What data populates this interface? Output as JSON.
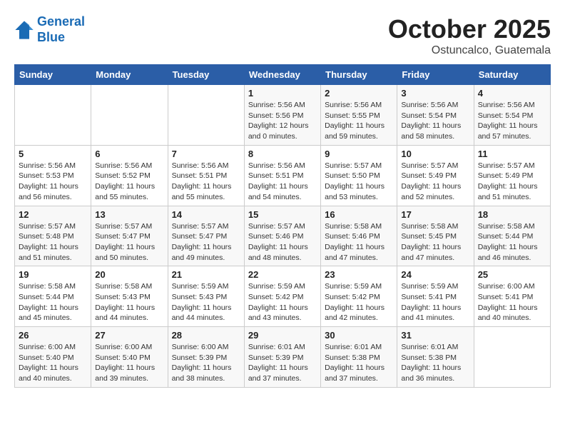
{
  "header": {
    "logo_line1": "General",
    "logo_line2": "Blue",
    "month": "October 2025",
    "location": "Ostuncalco, Guatemala"
  },
  "weekdays": [
    "Sunday",
    "Monday",
    "Tuesday",
    "Wednesday",
    "Thursday",
    "Friday",
    "Saturday"
  ],
  "weeks": [
    [
      {
        "day": "",
        "info": ""
      },
      {
        "day": "",
        "info": ""
      },
      {
        "day": "",
        "info": ""
      },
      {
        "day": "1",
        "info": "Sunrise: 5:56 AM\nSunset: 5:56 PM\nDaylight: 12 hours\nand 0 minutes."
      },
      {
        "day": "2",
        "info": "Sunrise: 5:56 AM\nSunset: 5:55 PM\nDaylight: 11 hours\nand 59 minutes."
      },
      {
        "day": "3",
        "info": "Sunrise: 5:56 AM\nSunset: 5:54 PM\nDaylight: 11 hours\nand 58 minutes."
      },
      {
        "day": "4",
        "info": "Sunrise: 5:56 AM\nSunset: 5:54 PM\nDaylight: 11 hours\nand 57 minutes."
      }
    ],
    [
      {
        "day": "5",
        "info": "Sunrise: 5:56 AM\nSunset: 5:53 PM\nDaylight: 11 hours\nand 56 minutes."
      },
      {
        "day": "6",
        "info": "Sunrise: 5:56 AM\nSunset: 5:52 PM\nDaylight: 11 hours\nand 55 minutes."
      },
      {
        "day": "7",
        "info": "Sunrise: 5:56 AM\nSunset: 5:51 PM\nDaylight: 11 hours\nand 55 minutes."
      },
      {
        "day": "8",
        "info": "Sunrise: 5:56 AM\nSunset: 5:51 PM\nDaylight: 11 hours\nand 54 minutes."
      },
      {
        "day": "9",
        "info": "Sunrise: 5:57 AM\nSunset: 5:50 PM\nDaylight: 11 hours\nand 53 minutes."
      },
      {
        "day": "10",
        "info": "Sunrise: 5:57 AM\nSunset: 5:49 PM\nDaylight: 11 hours\nand 52 minutes."
      },
      {
        "day": "11",
        "info": "Sunrise: 5:57 AM\nSunset: 5:49 PM\nDaylight: 11 hours\nand 51 minutes."
      }
    ],
    [
      {
        "day": "12",
        "info": "Sunrise: 5:57 AM\nSunset: 5:48 PM\nDaylight: 11 hours\nand 51 minutes."
      },
      {
        "day": "13",
        "info": "Sunrise: 5:57 AM\nSunset: 5:47 PM\nDaylight: 11 hours\nand 50 minutes."
      },
      {
        "day": "14",
        "info": "Sunrise: 5:57 AM\nSunset: 5:47 PM\nDaylight: 11 hours\nand 49 minutes."
      },
      {
        "day": "15",
        "info": "Sunrise: 5:57 AM\nSunset: 5:46 PM\nDaylight: 11 hours\nand 48 minutes."
      },
      {
        "day": "16",
        "info": "Sunrise: 5:58 AM\nSunset: 5:46 PM\nDaylight: 11 hours\nand 47 minutes."
      },
      {
        "day": "17",
        "info": "Sunrise: 5:58 AM\nSunset: 5:45 PM\nDaylight: 11 hours\nand 47 minutes."
      },
      {
        "day": "18",
        "info": "Sunrise: 5:58 AM\nSunset: 5:44 PM\nDaylight: 11 hours\nand 46 minutes."
      }
    ],
    [
      {
        "day": "19",
        "info": "Sunrise: 5:58 AM\nSunset: 5:44 PM\nDaylight: 11 hours\nand 45 minutes."
      },
      {
        "day": "20",
        "info": "Sunrise: 5:58 AM\nSunset: 5:43 PM\nDaylight: 11 hours\nand 44 minutes."
      },
      {
        "day": "21",
        "info": "Sunrise: 5:59 AM\nSunset: 5:43 PM\nDaylight: 11 hours\nand 44 minutes."
      },
      {
        "day": "22",
        "info": "Sunrise: 5:59 AM\nSunset: 5:42 PM\nDaylight: 11 hours\nand 43 minutes."
      },
      {
        "day": "23",
        "info": "Sunrise: 5:59 AM\nSunset: 5:42 PM\nDaylight: 11 hours\nand 42 minutes."
      },
      {
        "day": "24",
        "info": "Sunrise: 5:59 AM\nSunset: 5:41 PM\nDaylight: 11 hours\nand 41 minutes."
      },
      {
        "day": "25",
        "info": "Sunrise: 6:00 AM\nSunset: 5:41 PM\nDaylight: 11 hours\nand 40 minutes."
      }
    ],
    [
      {
        "day": "26",
        "info": "Sunrise: 6:00 AM\nSunset: 5:40 PM\nDaylight: 11 hours\nand 40 minutes."
      },
      {
        "day": "27",
        "info": "Sunrise: 6:00 AM\nSunset: 5:40 PM\nDaylight: 11 hours\nand 39 minutes."
      },
      {
        "day": "28",
        "info": "Sunrise: 6:00 AM\nSunset: 5:39 PM\nDaylight: 11 hours\nand 38 minutes."
      },
      {
        "day": "29",
        "info": "Sunrise: 6:01 AM\nSunset: 5:39 PM\nDaylight: 11 hours\nand 37 minutes."
      },
      {
        "day": "30",
        "info": "Sunrise: 6:01 AM\nSunset: 5:38 PM\nDaylight: 11 hours\nand 37 minutes."
      },
      {
        "day": "31",
        "info": "Sunrise: 6:01 AM\nSunset: 5:38 PM\nDaylight: 11 hours\nand 36 minutes."
      },
      {
        "day": "",
        "info": ""
      }
    ]
  ]
}
